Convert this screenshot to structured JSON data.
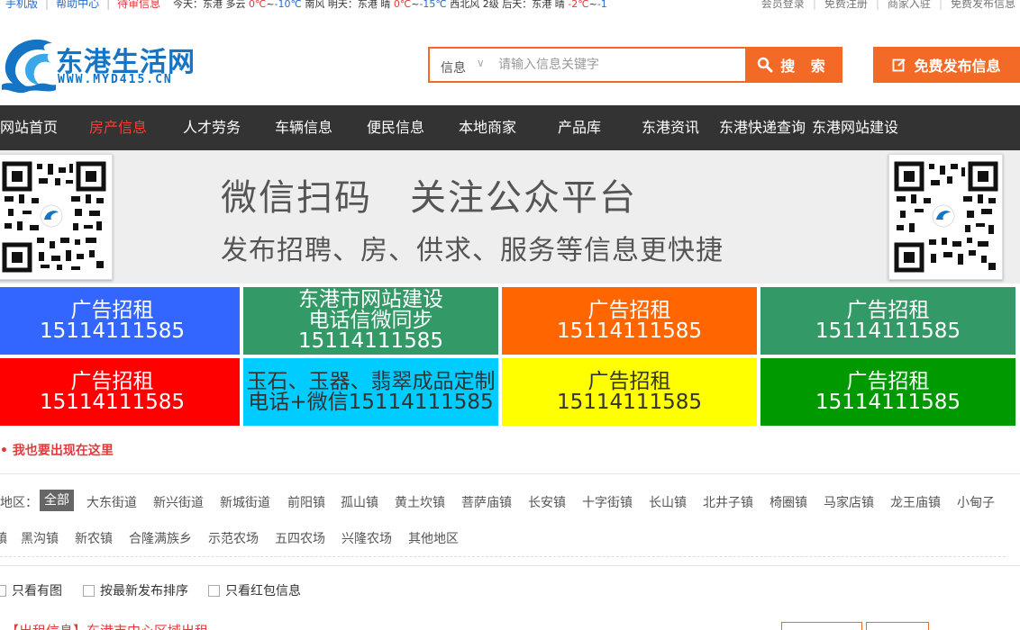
{
  "topbar": {
    "mobile": "手机版",
    "help": "帮助中心",
    "pending": "待审信息",
    "weather": {
      "today_label": "今天：东港 多云",
      "today_high": "0℃",
      "today_sep": "~",
      "today_low": "-10℃",
      "today_wind": "南风",
      "tomorrow_label": "明天：东港 晴",
      "tomorrow_high": "0℃",
      "tomorrow_sep": "~",
      "tomorrow_low": "-15℃",
      "tomorrow_wind": "西北风 2级",
      "after_label": "后天：东港 晴",
      "after_high": "-2℃",
      "after_sep": "~",
      "after_low": "-1"
    },
    "member_login": "会员登录",
    "register": "免费注册",
    "merchant_join": "商家入驻",
    "free_publish": "免费发布信息"
  },
  "header": {
    "logo_title": "东港生活网",
    "logo_url": "WWW.MYD415.CN",
    "search_category": "信息",
    "search_placeholder": "请输入信息关键字",
    "search_button": "搜 索",
    "publish_button": "免费发布信息"
  },
  "nav": {
    "items": [
      {
        "label": "网站首页"
      },
      {
        "label": "房产信息",
        "active": true
      },
      {
        "label": "人才劳务"
      },
      {
        "label": "车辆信息"
      },
      {
        "label": "便民信息"
      },
      {
        "label": "本地商家"
      },
      {
        "label": "产品库"
      },
      {
        "label": "东港资讯"
      },
      {
        "label": "东港快递查询"
      },
      {
        "label": "东港网站建设"
      }
    ]
  },
  "banner": {
    "line1": "微信扫码　关注公众平台",
    "line2": "发布招聘、房、供求、服务等信息更快捷"
  },
  "ads": [
    {
      "title": "广告招租",
      "phone": "15114111585",
      "color": "#3366ff"
    },
    {
      "title": "东港市网站建设",
      "phone": "电话信微同步15114111585",
      "color": "#339966"
    },
    {
      "title": "广告招租",
      "phone": "15114111585",
      "color": "#ff6600"
    },
    {
      "title": "广告招租",
      "phone": "15114111585",
      "color": "#339966"
    },
    {
      "title": "广告招租",
      "phone": "15114111585",
      "color": "#ff0000"
    },
    {
      "title": "玉石、玉器、翡翠成品定制",
      "phone": "电话+微信15114111585",
      "color": "#00ccff"
    },
    {
      "title": "广告招租",
      "phone": "15114111585",
      "color": "#ffff00"
    },
    {
      "title": "广告招租",
      "phone": "15114111585",
      "color": "#009900"
    }
  ],
  "promo": "我也要出现在这里",
  "area": {
    "label": "地区：",
    "tags": [
      "全部",
      "大东街道",
      "新兴街道",
      "新城街道",
      "前阳镇",
      "孤山镇",
      "黄土坎镇",
      "菩萨庙镇",
      "长安镇",
      "十字街镇",
      "长山镇",
      "北井子镇",
      "椅圈镇",
      "马家店镇",
      "龙王庙镇",
      "小甸子"
    ],
    "row2": [
      "镇",
      "黑沟镇",
      "新农镇",
      "合隆满族乡",
      "示范农场",
      "五四农场",
      "兴隆农场",
      "其他地区"
    ]
  },
  "filters": {
    "with_image": "只看有图",
    "latest": "按最新发布排序",
    "red_packet": "只看红包信息"
  },
  "listing": {
    "partial_text": "【出租信息】东港市中心区域出租……"
  }
}
